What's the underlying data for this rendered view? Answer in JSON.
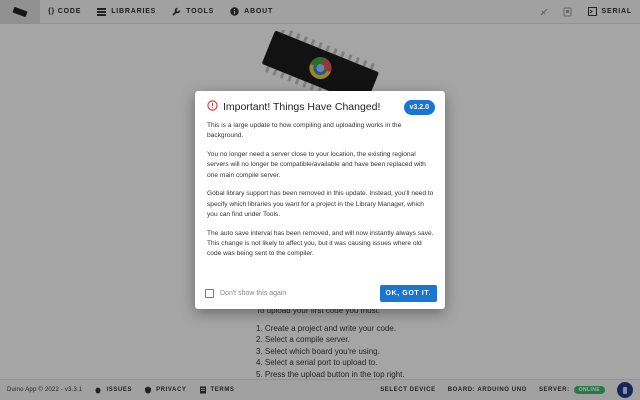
{
  "nav": {
    "items": [
      {
        "label": "{} CODE",
        "icon": "code-icon"
      },
      {
        "label": "LIBRARIES",
        "icon": "library-icon"
      },
      {
        "label": "TOOLS",
        "icon": "wrench-icon"
      },
      {
        "label": "ABOUT",
        "icon": "info-icon"
      }
    ],
    "serial_label": "SERIAL"
  },
  "background": {
    "intro": "To upload your first code you must:",
    "steps": [
      "1. Create a project and write your code.",
      "2. Select a compile server.",
      "3. Select which board you're using.",
      "4. Select a serial port to upload to.",
      "5. Press the upload button in the top right."
    ]
  },
  "footer": {
    "copyright": "Duino App © 2022 - v3.3.1",
    "issues_label": "ISSUES",
    "privacy_label": "PRIVACY",
    "terms_label": "TERMS",
    "select_device_label": "SELECT DEVICE",
    "board_label": "BOARD: ARDUINO UNO",
    "server_label": "SERVER:",
    "server_status": "ONLINE"
  },
  "dialog": {
    "title": "Important! Things Have Changed!",
    "version": "v3.2.0",
    "paragraphs": [
      "This is a large update to how compiling and uploading works in the background.",
      "You no longer need a server close to your location, the existing regional servers will no longer be compatible/available and have been replaced with one main compile server.",
      "Gobal library support has been removed in this update. Instead, you'll need to specify which libraries you want for a project in the Library Manager, which you can find under Tools.",
      "The auto save interval has been removed, and will now instantly always save. This change is not likely to affect you, but it was causing issues where old code was being sent to the compiler."
    ],
    "checkbox_label": "Don't show this again",
    "ok_label": "OK, GOT IT."
  },
  "colors": {
    "accent": "#1976d2",
    "online": "#3bb36a",
    "warning": "#e53935"
  }
}
